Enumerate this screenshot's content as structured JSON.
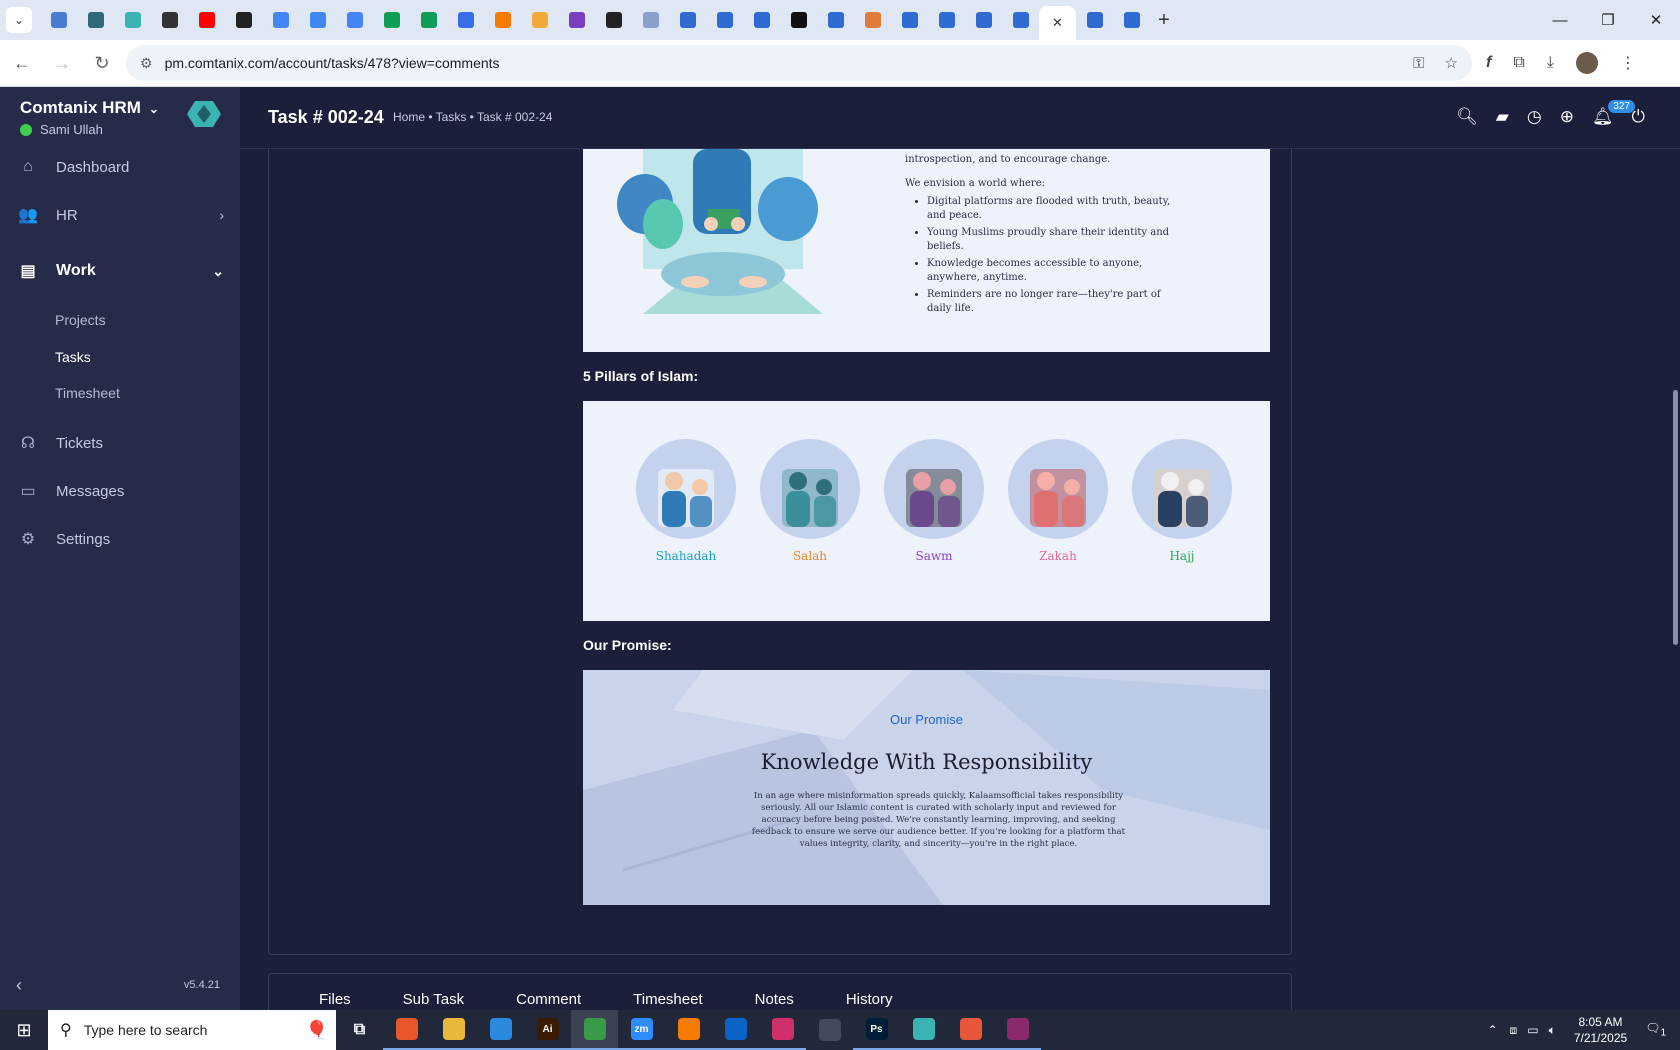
{
  "browser": {
    "tabs": [
      {
        "icon": "app-icon",
        "color": "#4a7bd0"
      },
      {
        "icon": "vpn-icon",
        "color": "#2e6b78"
      },
      {
        "icon": "app-icon",
        "color": "#3bb3b3"
      },
      {
        "icon": "chatgpt-icon",
        "color": "#333333"
      },
      {
        "icon": "youtube-icon",
        "color": "#ff0000"
      },
      {
        "icon": "bolt-icon",
        "color": "#222222"
      },
      {
        "icon": "docs-icon",
        "color": "#4285f4"
      },
      {
        "icon": "docs-icon",
        "color": "#4285f4"
      },
      {
        "icon": "docs-icon",
        "color": "#4285f4"
      },
      {
        "icon": "sheets-icon",
        "color": "#0f9d58"
      },
      {
        "icon": "sheets-icon",
        "color": "#0f9d58"
      },
      {
        "icon": "app-icon",
        "color": "#3a6ee8"
      },
      {
        "icon": "xampp-icon",
        "color": "#f57c00"
      },
      {
        "icon": "app-icon",
        "color": "#f2a93b"
      },
      {
        "icon": "code-icon",
        "color": "#7a3fbf"
      },
      {
        "icon": "app-icon",
        "color": "#222222"
      },
      {
        "icon": "app-icon",
        "color": "#8aa0c8"
      },
      {
        "icon": "forms-icon",
        "color": "#2f6ad0"
      },
      {
        "icon": "forms-icon",
        "color": "#2f6ad0"
      },
      {
        "icon": "forms-icon",
        "color": "#2f6ad0"
      },
      {
        "icon": "app-icon",
        "color": "#111111"
      },
      {
        "icon": "forms-icon",
        "color": "#2f6ad0"
      },
      {
        "icon": "app-icon",
        "color": "#e07b3a"
      },
      {
        "icon": "forms-icon",
        "color": "#2f6ad0"
      },
      {
        "icon": "forms-icon",
        "color": "#2f6ad0"
      },
      {
        "icon": "forms-icon",
        "color": "#2f6ad0"
      },
      {
        "icon": "forms-icon",
        "color": "#2f6ad0"
      },
      {
        "icon": "forms-icon",
        "color": "#2f6ad0"
      },
      {
        "icon": "forms-icon",
        "color": "#2f6ad0"
      }
    ],
    "url": "pm.comtanix.com/account/tasks/478?view=comments"
  },
  "sidebar": {
    "brand": "Comtanix HRM",
    "user": "Sami Ullah",
    "items": [
      {
        "label": "Dashboard"
      },
      {
        "label": "HR"
      },
      {
        "label": "Work"
      },
      {
        "label": "Tickets"
      },
      {
        "label": "Messages"
      },
      {
        "label": "Settings"
      }
    ],
    "work_sub": [
      {
        "label": "Projects"
      },
      {
        "label": "Tasks"
      },
      {
        "label": "Timesheet"
      }
    ],
    "version": "v5.4.21"
  },
  "header": {
    "title": "Task # 002-24",
    "breadcrumb": "Home • Tasks • Task # 002-24",
    "notification_count": "327"
  },
  "content": {
    "vision_lead": "introspection, and to encourage change.",
    "vision_intro": "We envision a world where:",
    "vision_points": [
      "Digital platforms are flooded with truth, beauty, and peace.",
      "Young Muslims proudly share their identity and beliefs.",
      "Knowledge becomes accessible to anyone, anywhere, anytime.",
      "Reminders are no longer rare—they're part of daily life."
    ],
    "pillars_label": "5 Pillars of Islam:",
    "pillars": [
      {
        "name": "Shahadah",
        "color": "#1aa0c8"
      },
      {
        "name": "Salah",
        "color": "#e88a2a"
      },
      {
        "name": "Sawm",
        "color": "#8a3fd0"
      },
      {
        "name": "Zakah",
        "color": "#e86a9a"
      },
      {
        "name": "Hajj",
        "color": "#2aa85a"
      }
    ],
    "promise_label": "Our Promise:",
    "promise_kicker": "Our Promise",
    "promise_title": "Knowledge With Responsibility",
    "promise_body": "In an age where misinformation spreads quickly, Kalaamsofficial takes responsibility seriously. All our Islamic content is curated with scholarly input and reviewed for accuracy before being posted. We're constantly learning, improving, and seeking feedback to ensure we serve our audience better. If you're looking for a platform that values integrity, clarity, and sincerity—you're in the right place."
  },
  "task_tabs": [
    {
      "label": "Files"
    },
    {
      "label": "Sub Task"
    },
    {
      "label": "Comment"
    },
    {
      "label": "Timesheet"
    },
    {
      "label": "Notes"
    },
    {
      "label": "History"
    }
  ],
  "taskbar": {
    "search_placeholder": "Type here to search",
    "time": "8:05 AM",
    "date": "7/21/2025",
    "notif": "1",
    "apps": [
      {
        "label": "",
        "icon": "task-view-icon",
        "color": "#20283a"
      },
      {
        "label": "",
        "icon": "firefox-icon",
        "color": "#e8572a"
      },
      {
        "label": "",
        "icon": "folder-icon",
        "color": "#e8b83a"
      },
      {
        "label": "",
        "icon": "vscode-icon",
        "color": "#2a8ae0"
      },
      {
        "label": "Ai",
        "icon": "illustrator-icon",
        "color": "#3a1a00"
      },
      {
        "label": "",
        "icon": "chrome-icon",
        "color": "#3a9a4a"
      },
      {
        "label": "zm",
        "icon": "zoom-icon",
        "color": "#2d8cff"
      },
      {
        "label": "",
        "icon": "xampp-icon",
        "color": "#f57c00"
      },
      {
        "label": "",
        "icon": "outlook-icon",
        "color": "#0a64c8"
      },
      {
        "label": "",
        "icon": "creative-cloud-icon",
        "color": "#d0306a"
      },
      {
        "label": "",
        "icon": "pen-icon",
        "color": "#444a5a"
      },
      {
        "label": "Ps",
        "icon": "photoshop-icon",
        "color": "#001e36"
      },
      {
        "label": "",
        "icon": "app-icon",
        "color": "#3bb3b3"
      },
      {
        "label": "",
        "icon": "app-icon",
        "color": "#e8573a"
      },
      {
        "label": "",
        "icon": "winrar-icon",
        "color": "#8a2a6a"
      }
    ]
  }
}
